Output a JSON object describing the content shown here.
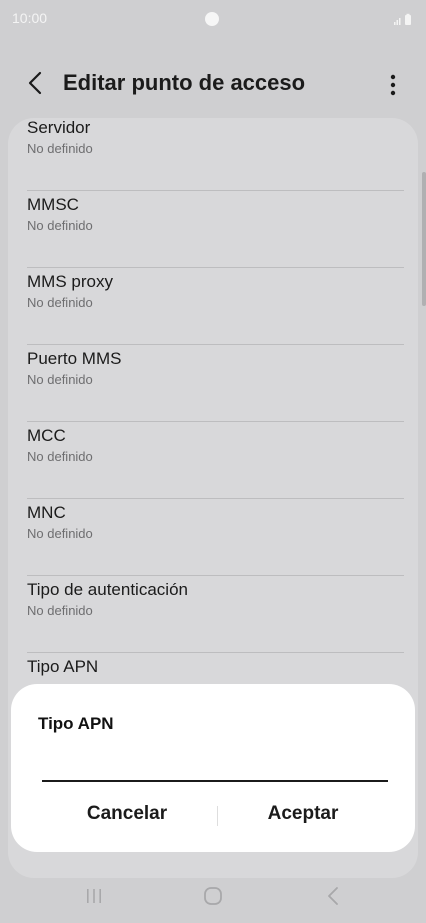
{
  "status_bar": {
    "time": "10:00",
    "signal_icon": "signal-icon",
    "battery_icon": "battery-icon"
  },
  "header": {
    "title": "Editar punto de acceso",
    "back_icon": "back-icon",
    "more_icon": "more-vertical-icon"
  },
  "settings": {
    "items": [
      {
        "title": "Servidor",
        "subtitle": "No definido"
      },
      {
        "title": "MMSC",
        "subtitle": "No definido"
      },
      {
        "title": "MMS proxy",
        "subtitle": "No definido"
      },
      {
        "title": "Puerto MMS",
        "subtitle": "No definido"
      },
      {
        "title": "MCC",
        "subtitle": "No definido"
      },
      {
        "title": "MNC",
        "subtitle": "No definido"
      },
      {
        "title": "Tipo de autenticación",
        "subtitle": "No definido"
      },
      {
        "title": "Tipo APN",
        "subtitle": ""
      }
    ]
  },
  "dialog": {
    "title": "Tipo APN",
    "input_value": "",
    "cancel_label": "Cancelar",
    "accept_label": "Aceptar"
  },
  "nav_bar": {
    "recent_icon": "recent-apps-icon",
    "home_icon": "home-icon",
    "back_icon": "nav-back-icon"
  },
  "colors": {
    "dim_background": "#cfcfd1",
    "card_background": "#d8d8da",
    "dialog_background": "#ffffff",
    "text_primary": "#1b1b1b",
    "text_secondary": "#6e6e70"
  }
}
